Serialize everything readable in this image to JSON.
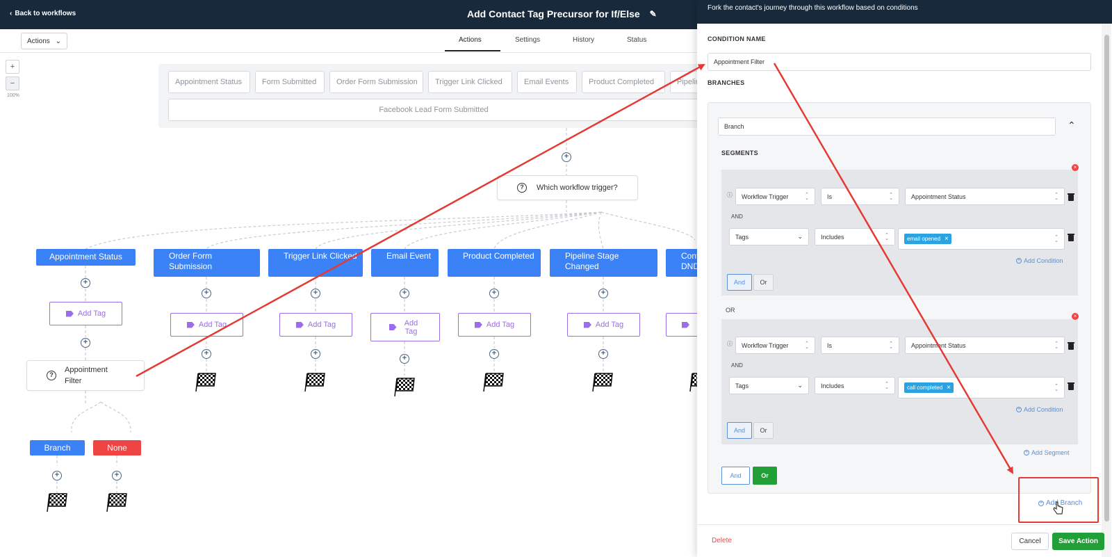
{
  "topbar": {
    "back_label": "Back to workflows",
    "title": "Add Contact Tag Precursor for If/Else"
  },
  "subbar": {
    "actions_label": "Actions",
    "tabs": [
      "Actions",
      "Settings",
      "History",
      "Status"
    ]
  },
  "zoom": {
    "plus": "+",
    "minus": "−",
    "level": "100%"
  },
  "triggers": {
    "chips": [
      "Appointment Status",
      "Form Submitted",
      "Order Form Submission",
      "Trigger Link Clicked",
      "Email Events",
      "Product Completed",
      "Pipeline"
    ],
    "wide": "Facebook Lead Form Submitted"
  },
  "flow": {
    "question": "Which workflow trigger?",
    "branches": [
      {
        "label": "Appointment Status"
      },
      {
        "label": "Order Form Submission"
      },
      {
        "label": "Trigger Link Clicked"
      },
      {
        "label": "Email Event"
      },
      {
        "label": "Product Completed"
      },
      {
        "label": "Pipeline Stage Changed"
      },
      {
        "label": "Cont DND"
      }
    ],
    "add_tag": "Add Tag",
    "filter_node": "Appointment Filter",
    "branch_btn": "Branch",
    "none_btn": "None"
  },
  "panel": {
    "description": "Fork the contact's journey through this workflow based on conditions",
    "condition_name_label": "CONDITION NAME",
    "condition_name_value": "Appointment Filter",
    "branches_label": "BRANCHES",
    "branch_name": "Branch",
    "segments_label": "SEGMENTS",
    "segments": [
      {
        "field": "Workflow Trigger",
        "op": "Is",
        "value": "Appointment Status",
        "and_label": "AND",
        "tag_field": "Tags",
        "tag_op": "Includes",
        "tag_chip": "email opened",
        "add_condition": "Add Condition",
        "and_btn": "And",
        "or_btn": "Or"
      },
      {
        "field": "Workflow Trigger",
        "op": "Is",
        "value": "Appointment Status",
        "and_label": "AND",
        "tag_field": "Tags",
        "tag_op": "Includes",
        "tag_chip": "call completed",
        "add_condition": "Add Condition",
        "and_btn": "And",
        "or_btn": "Or"
      }
    ],
    "or_label": "OR",
    "add_segment": "Add Segment",
    "branch_and": "And",
    "branch_or": "Or",
    "add_branch": "Add Branch",
    "delete": "Delete",
    "cancel": "Cancel",
    "save": "Save Action"
  },
  "colors": {
    "header": "#17293a",
    "node_blue": "#3b82f6",
    "tag_purple": "#9b6ee8",
    "save_green": "#22a038",
    "annotation_red": "#e53935"
  }
}
